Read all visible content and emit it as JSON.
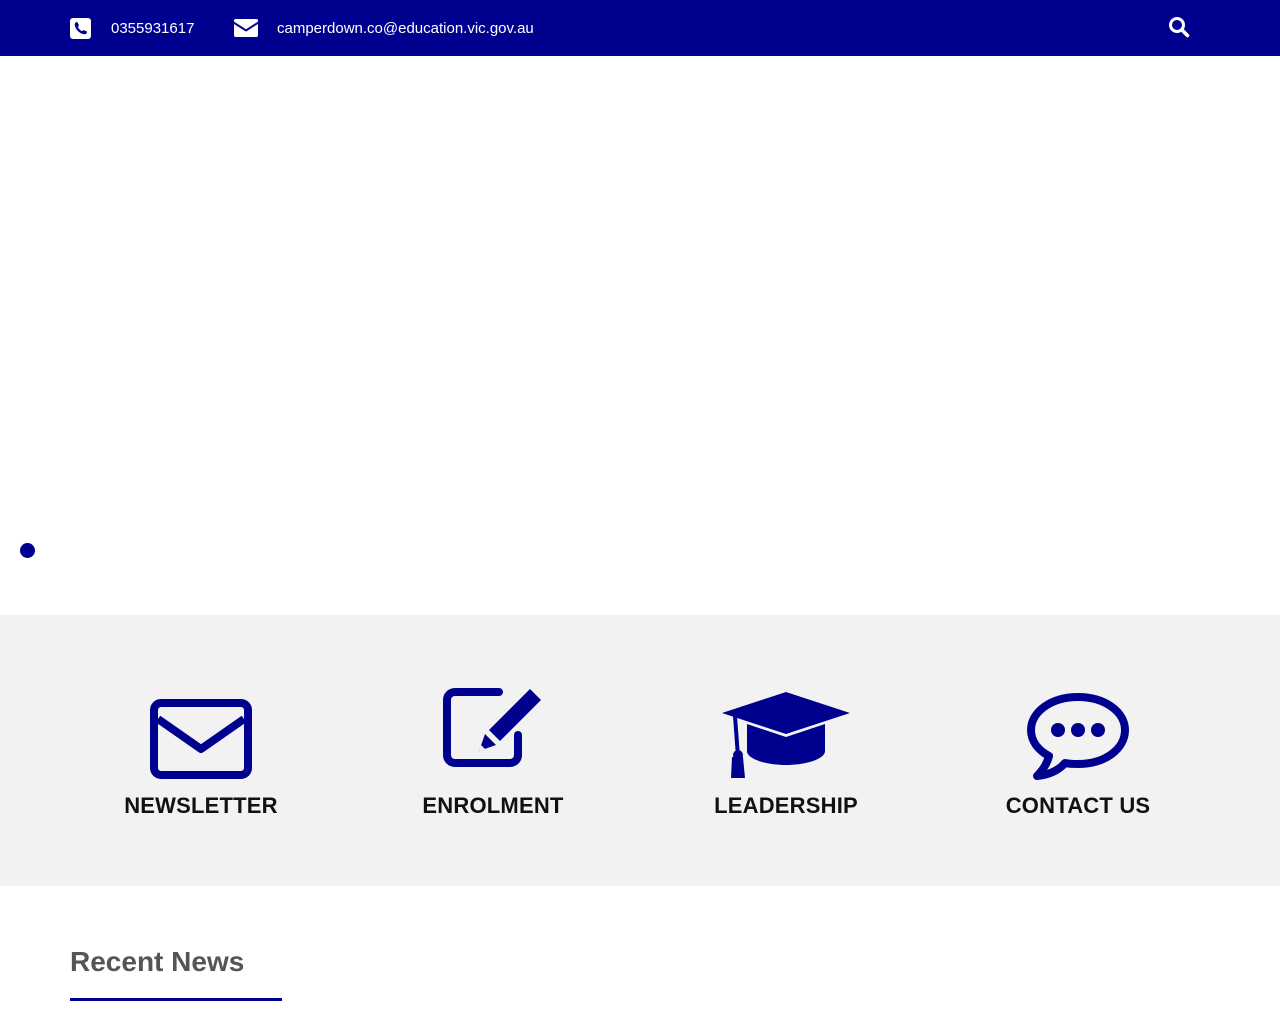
{
  "topbar": {
    "phone": "0355931617",
    "email": "camperdown.co@education.vic.gov.au",
    "phone_icon": "phone-square-icon",
    "email_icon": "envelope-icon",
    "search_icon": "search-icon"
  },
  "hero": {
    "slider_dot_icon": "slider-dot"
  },
  "quicklinks": [
    {
      "label": "NEWSLETTER",
      "icon": "envelope-outline-icon"
    },
    {
      "label": "ENROLMENT",
      "icon": "edit-pencil-icon"
    },
    {
      "label": "LEADERSHIP",
      "icon": "graduation-cap-icon"
    },
    {
      "label": "CONTACT US",
      "icon": "speech-bubble-icon"
    }
  ],
  "recent_news": {
    "title": "Recent News"
  },
  "colors": {
    "brand": "#00008f",
    "topbar_text": "#ffffff",
    "quicklinks_bg": "#f2f2f2",
    "heading_gray": "#555555"
  }
}
